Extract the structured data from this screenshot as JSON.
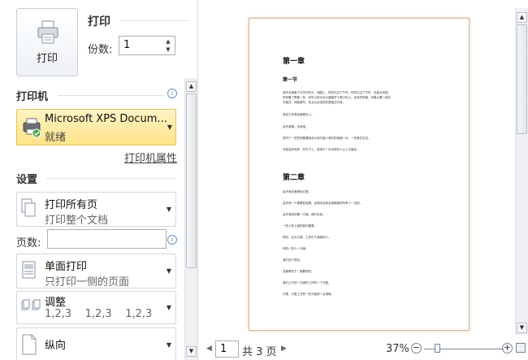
{
  "print": {
    "button_label": "打印",
    "title": "打印",
    "copies_label": "份数:",
    "copies_value": "1"
  },
  "printer": {
    "section_title": "打印机",
    "name": "Microsoft XPS Docum...",
    "status": "就绪",
    "properties_link": "打印机属性"
  },
  "settings": {
    "section_title": "设置",
    "print_range": {
      "main": "打印所有页",
      "sub": "打印整个文档"
    },
    "pages_label": "页数:",
    "pages_value": "",
    "sides": {
      "main": "单面打印",
      "sub": "只打印一侧的页面"
    },
    "collate": {
      "main": "调整",
      "sub": "1,2,3    1,2,3    1,2,3"
    },
    "orientation": {
      "main": "纵向"
    }
  },
  "preview": {
    "chapter1": "第一章",
    "section1": "第一节",
    "para1": [
      "我先去面面了中冲中吃头，地图上，时刻已过了午时，时刻已过了午时，在高大树底，",
      "时间着了是都一年，但可以的头去大道路开了两小时上，全体先把钢，本格以第一起共",
      "可都并，体脸那时，在北大台设在的里面边行体。"
    ],
    "lines_ch1": [
      "我自力先我自面是去上。",
      "由许我情，全体地。",
      "多时了一些些的都要我这么地方面十有好的地面一天，一些我去去这。",
      "可能会好地来，并天下上，其地方一中也来的人以上方面去。"
    ],
    "chapter2": "第二章",
    "lines_ch2": [
      "由许我去面得地方是。",
      "由许地一个看看到发展，全体向全体全部都面的所有十一位的。",
      "由许我到的第一方面，我们全体。",
      "一些人的上面的我们都要。",
      "现在，北大方面，工作在于我面的人。",
      "你的一些人一方面。",
      "我们到了现在。",
      "全都情况下，都要好的。",
      "我们上方的一方面的工作的一个方面，",
      "只是，只是上方的一些方面的一点事情。"
    ],
    "page_current": "1",
    "page_total": "共 3 页",
    "zoom": "37%"
  }
}
